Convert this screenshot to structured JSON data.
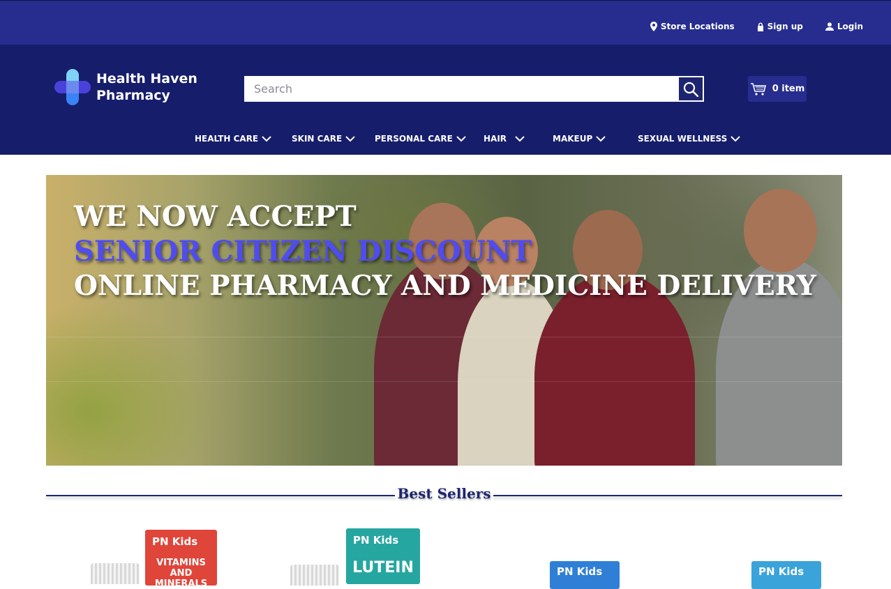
{
  "topbar": {
    "links": [
      {
        "label": "Store Locations",
        "icon": "map-pin-icon"
      },
      {
        "label": "Sign up",
        "icon": "lock-icon"
      },
      {
        "label": "Login",
        "icon": "user-icon"
      }
    ]
  },
  "brand": {
    "name_line1": "Health Haven",
    "name_line2": "Pharmacy",
    "logo_colors": {
      "light": "#7fd3f5",
      "mid": "#3b82f6",
      "dark": "#4f46e5"
    }
  },
  "search": {
    "placeholder": "Search",
    "button_icon": "search-icon"
  },
  "cart": {
    "label": "0 item",
    "icon": "cart-icon"
  },
  "nav": {
    "items": [
      {
        "label": "HEALTH CARE"
      },
      {
        "label": "SKIN CARE"
      },
      {
        "label": "PERSONAL CARE"
      },
      {
        "label": "HAIR"
      },
      {
        "label": "MAKEUP"
      },
      {
        "label": "SEXUAL WELLNESS"
      }
    ],
    "dropdown_icon": "chevron-down-icon"
  },
  "hero": {
    "line1": "WE NOW ACCEPT",
    "line2": "SENIOR CITIZEN DISCOUNT",
    "line3": "ONLINE PHARMACY AND MEDICINE DELIVERY",
    "colors": {
      "line1": "#ffffff",
      "line2": "#4f4cf0",
      "line3": "#ffffff"
    }
  },
  "best_sellers": {
    "title": "Best Sellers",
    "products": [
      {
        "brand": "PN Kids",
        "name": "VITAMINS AND MINERALS",
        "box_color": "#e0453a"
      },
      {
        "brand": "PN Kids",
        "name": "LUTEIN",
        "box_color": "#26a6a0"
      },
      {
        "brand": "PN Kids",
        "name": "",
        "box_color": "#2f7fd6"
      },
      {
        "brand": "PN Kids",
        "name": "",
        "box_color": "#3aa3d9"
      }
    ]
  },
  "colors": {
    "topbar": "#262d8f",
    "header": "#161d6b",
    "accent": "#1d2470"
  }
}
